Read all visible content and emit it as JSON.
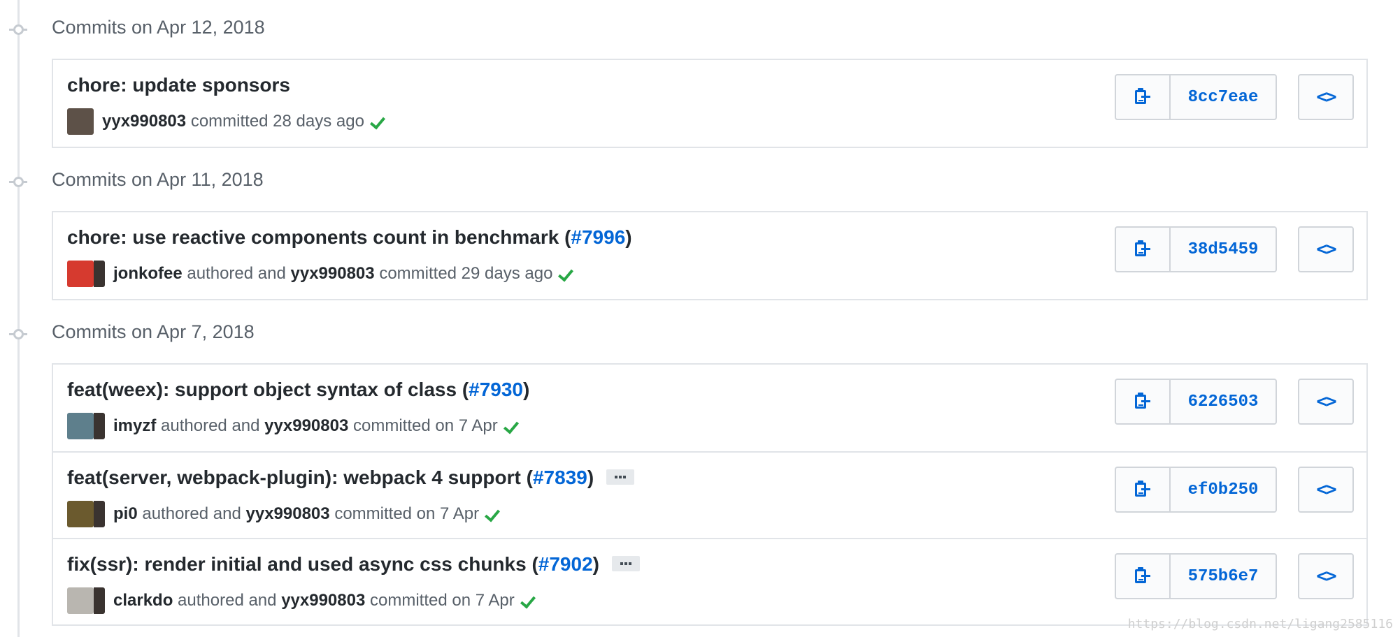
{
  "groups": [
    {
      "title": "Commits on Apr 12, 2018",
      "commits": [
        {
          "message": "chore: update sponsors",
          "pr": "",
          "pr_close": "",
          "has_ellipsis": false,
          "author": "yyx990803",
          "authored_text": "",
          "committer": "",
          "committed_text": "committed 28 days ago",
          "avatar_colors": [
            "#5d5148"
          ],
          "sha": "8cc7eae"
        }
      ]
    },
    {
      "title": "Commits on Apr 11, 2018",
      "commits": [
        {
          "message": "chore: use reactive components count in benchmark (",
          "pr": "#7996",
          "pr_close": ")",
          "has_ellipsis": false,
          "author": "jonkofee",
          "authored_text": "authored and",
          "committer": "yyx990803",
          "committed_text": "committed 29 days ago",
          "avatar_colors": [
            "#d63a2f",
            "#3a3330"
          ],
          "sha": "38d5459"
        }
      ]
    },
    {
      "title": "Commits on Apr 7, 2018",
      "commits": [
        {
          "message": "feat(weex): support object syntax of class (",
          "pr": "#7930",
          "pr_close": ")",
          "has_ellipsis": false,
          "author": "imyzf",
          "authored_text": "authored and",
          "committer": "yyx990803",
          "committed_text": "committed on 7 Apr",
          "avatar_colors": [
            "#5e7f8c",
            "#3a3330"
          ],
          "sha": "6226503"
        },
        {
          "message": "feat(server, webpack-plugin): webpack 4 support (",
          "pr": "#7839",
          "pr_close": ")",
          "has_ellipsis": true,
          "author": "pi0",
          "authored_text": "authored and",
          "committer": "yyx990803",
          "committed_text": "committed on 7 Apr",
          "avatar_colors": [
            "#6b5a2e",
            "#3a3330"
          ],
          "sha": "ef0b250"
        },
        {
          "message": "fix(ssr): render initial and used async css chunks (",
          "pr": "#7902",
          "pr_close": ")",
          "has_ellipsis": true,
          "author": "clarkdo",
          "authored_text": "authored and",
          "committer": "yyx990803",
          "committed_text": "committed on 7 Apr",
          "avatar_colors": [
            "#b9b6b0",
            "#3a3330"
          ],
          "sha": "575b6e7"
        }
      ]
    }
  ],
  "icons": {
    "copy": "clipboard-copy-icon",
    "browse": "code-brackets-icon",
    "status": "check-icon"
  },
  "code_glyph": "<>",
  "colors": {
    "link": "#0366d6",
    "success": "#28a745",
    "border": "#e1e4e8"
  },
  "watermark": "https://blog.csdn.net/ligang2585116"
}
